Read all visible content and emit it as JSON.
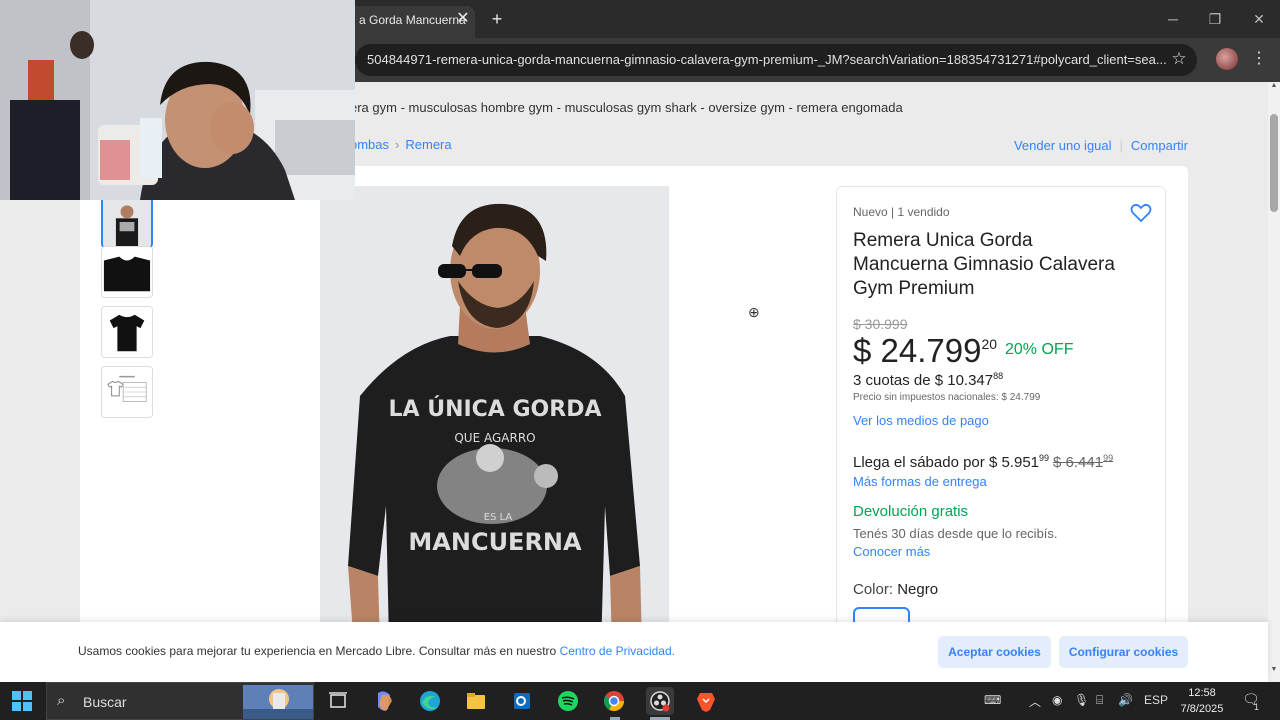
{
  "browser": {
    "tab_title": "a Gorda Mancuerna",
    "url": "504844971-remera-unica-gorda-mancuerna-gimnasio-calavera-gym-premium-_JM?searchVariation=188354731271#polycard_client=sea..."
  },
  "page": {
    "search_terms": "era gym - musculosas hombre gym - musculosas gym shark - oversize gym - remera engomada",
    "breadcrumb": [
      "ombas",
      "Remera"
    ],
    "sell_link": "Vender uno igual",
    "share_link": "Compartir"
  },
  "product": {
    "condition": "Nuevo  |  1 vendido",
    "title": "Remera Unica Gorda Mancuerna Gimnasio Calavera Gym Premium",
    "old_price": "$ 30.999",
    "price": "$ 24.799",
    "price_cents": "20",
    "discount": "20% OFF",
    "installments": "3 cuotas de $ 10.347",
    "installments_cents": "88",
    "tax_note": "Precio sin impuestos nacionales: $ 24.799",
    "payment_link": "Ver los medios de pago",
    "delivery_prefix": "Llega el sábado por",
    "delivery_price": "$ 5.951",
    "delivery_price_cents": "99",
    "delivery_old_price": "$ 6.441",
    "delivery_old_price_cents": "99",
    "delivery_link": "Más formas de entrega",
    "return_title": "Devolución gratis",
    "return_note": "Tenés 30 días desde que lo recibís.",
    "return_link": "Conocer más",
    "color_label": "Color:",
    "color_value": "Negro",
    "shirt_print": {
      "line1": "LA ÚNICA GORDA",
      "line2": "QUE AGARRO",
      "line3": "ES LA",
      "line4": "MANCUERNA"
    }
  },
  "cookie_bar": {
    "text": "Usamos cookies para mejorar tu experiencia en Mercado Libre. Consultar más en nuestro",
    "link": "Centro de Privacidad.",
    "accept": "Aceptar cookies",
    "configure": "Configurar cookies"
  },
  "taskbar": {
    "search_placeholder": "Buscar",
    "language": "ESP",
    "time": "12:58",
    "date": "7/8/2025",
    "notification_count": "1"
  },
  "colors": {
    "accent_blue": "#3483fa",
    "green": "#00a650",
    "taskbar": "#202020"
  }
}
